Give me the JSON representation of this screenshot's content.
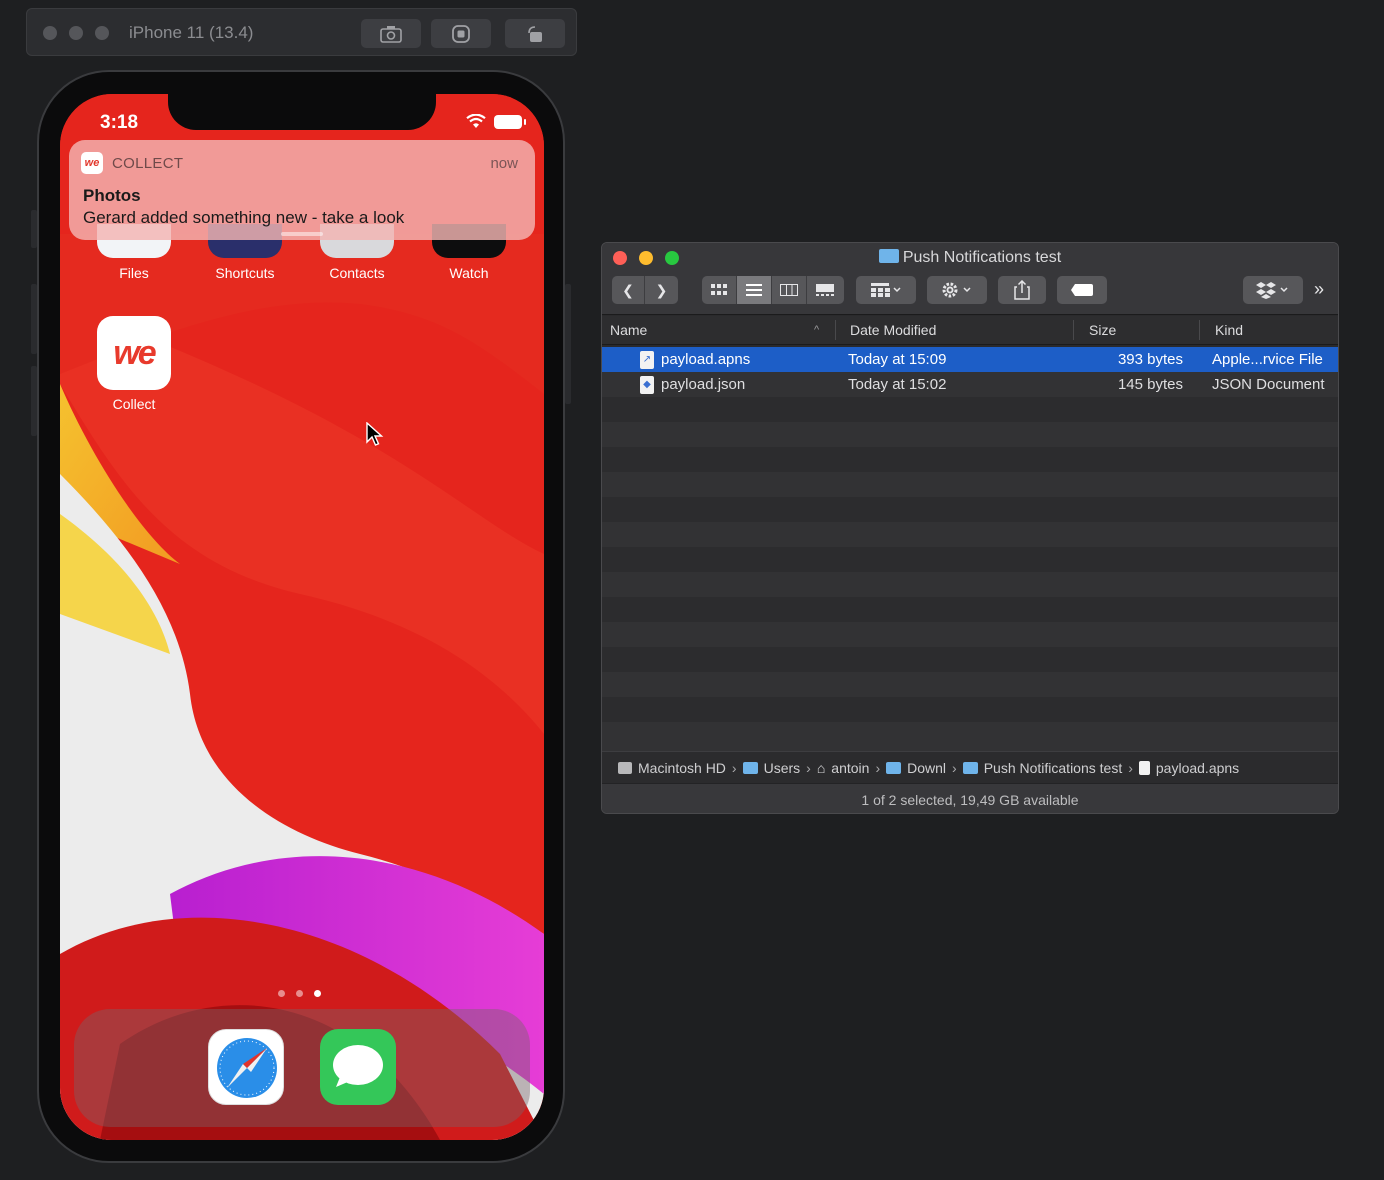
{
  "simulator": {
    "title": "iPhone 11 (13.4)",
    "buttons": [
      {
        "name": "screenshot-icon",
        "glyph": "⎘"
      },
      {
        "name": "home-icon",
        "glyph": "◉"
      },
      {
        "name": "rotate-icon",
        "glyph": "⟲"
      }
    ]
  },
  "phone": {
    "status_time": "3:18",
    "notification": {
      "app_icon_text": "we",
      "app_name": "COLLECT",
      "time": "now",
      "title": "Photos",
      "body": "Gerard added something new - take a look"
    },
    "apps": [
      {
        "label": "Files"
      },
      {
        "label": "Shortcuts"
      },
      {
        "label": "Contacts"
      },
      {
        "label": "Watch"
      },
      {
        "label": "Collect",
        "icon_text": "we"
      }
    ],
    "page_count": 3,
    "active_page": 3,
    "dock": [
      {
        "name": "safari-icon"
      },
      {
        "name": "messages-icon"
      }
    ]
  },
  "finder": {
    "title": "Push Notifications test",
    "columns": {
      "name": "Name",
      "date": "Date Modified",
      "size": "Size",
      "kind": "Kind"
    },
    "files": [
      {
        "name": "payload.apns",
        "date": "Today at 15:09",
        "size": "393 bytes",
        "kind": "Apple...rvice File",
        "selected": true
      },
      {
        "name": "payload.json",
        "date": "Today at 15:02",
        "size": "145 bytes",
        "kind": "JSON Document",
        "selected": false
      }
    ],
    "path": [
      "Macintosh HD",
      "Users",
      "antoin",
      "Downl",
      "Push Notifications test",
      "payload.apns"
    ],
    "status": "1 of 2 selected, 19,49 GB available"
  },
  "colors": {
    "selection": "#1d5ec7",
    "close": "#fe5f57",
    "minimize": "#febc2e",
    "zoom": "#28c840",
    "wallpaper_red": "#e5251d"
  }
}
